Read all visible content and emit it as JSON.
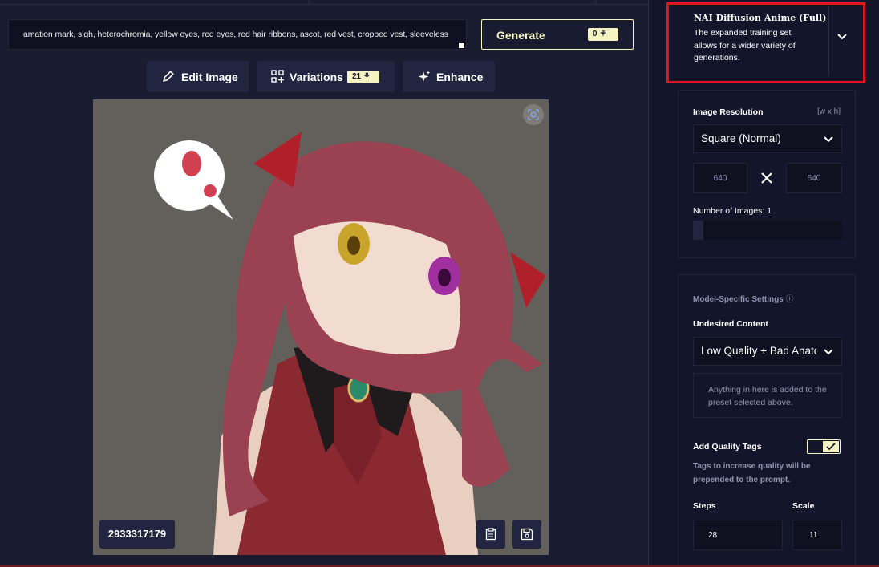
{
  "prompt": {
    "text": "amation mark, sigh, heterochromia, yellow eyes, red eyes, red hair ribbons, ascot, red vest, cropped vest, sleeveless"
  },
  "generate": {
    "label": "Generate",
    "cost": "0"
  },
  "toolbar": {
    "edit_label": "Edit Image",
    "variations_label": "Variations",
    "variations_cost": "21",
    "enhance_label": "Enhance"
  },
  "image": {
    "seed": "2933317179"
  },
  "model": {
    "name": "NAI Diffusion Anime (Full)",
    "description": "The expanded training set allows for a wider variety of generations."
  },
  "resolution": {
    "label": "Image Resolution",
    "hint": "[w x h]",
    "preset": "Square (Normal)",
    "width": "640",
    "height": "640",
    "num_images_label": "Number of Images:",
    "num_images": "1",
    "num_images_fraction": 0.07
  },
  "model_settings": {
    "title": "Model-Specific Settings",
    "undesired_label": "Undesired Content",
    "undesired_preset": "Low Quality + Bad Anatomy",
    "undesired_placeholder": "Anything in here is added to the preset selected above.",
    "quality_tags_label": "Add Quality Tags",
    "quality_tags_on": true,
    "quality_tags_desc": "Tags to increase quality will be prepended to the prompt.",
    "steps_label": "Steps",
    "steps_value": "28",
    "scale_label": "Scale",
    "scale_value": "11"
  },
  "colors": {
    "background": "#191b31",
    "panel": "#13152a",
    "accent": "#f5f3c2",
    "highlight": "#e0161f"
  }
}
